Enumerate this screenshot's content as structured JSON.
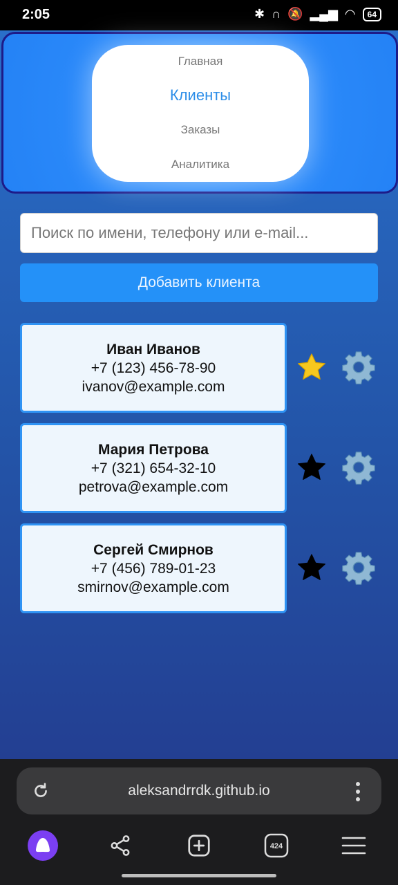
{
  "status_bar": {
    "time": "2:05",
    "battery": "64"
  },
  "nav": {
    "items": [
      "Главная",
      "Клиенты",
      "Заказы",
      "Аналитика"
    ],
    "active_index": 1
  },
  "search": {
    "placeholder": "Поиск по имени, телефону или e-mail...",
    "value": ""
  },
  "add_button": {
    "label": "Добавить клиента"
  },
  "clients": [
    {
      "name": "Иван Иванов",
      "phone": "+7 (123) 456-78-90",
      "email": "ivanov@example.com",
      "favorite": true
    },
    {
      "name": "Мария Петрова",
      "phone": "+7 (321) 654-32-10",
      "email": "petrova@example.com",
      "favorite": false
    },
    {
      "name": "Сергей Смирнов",
      "phone": "+7 (456) 789-01-23",
      "email": "smirnov@example.com",
      "favorite": false
    }
  ],
  "browser": {
    "url": "aleksandrrdk.github.io",
    "tab_count": "424"
  },
  "colors": {
    "accent": "#2491f8",
    "star_favorite": "#f7c81e",
    "star_default": "#000000",
    "gear": "#8fb8d4"
  }
}
